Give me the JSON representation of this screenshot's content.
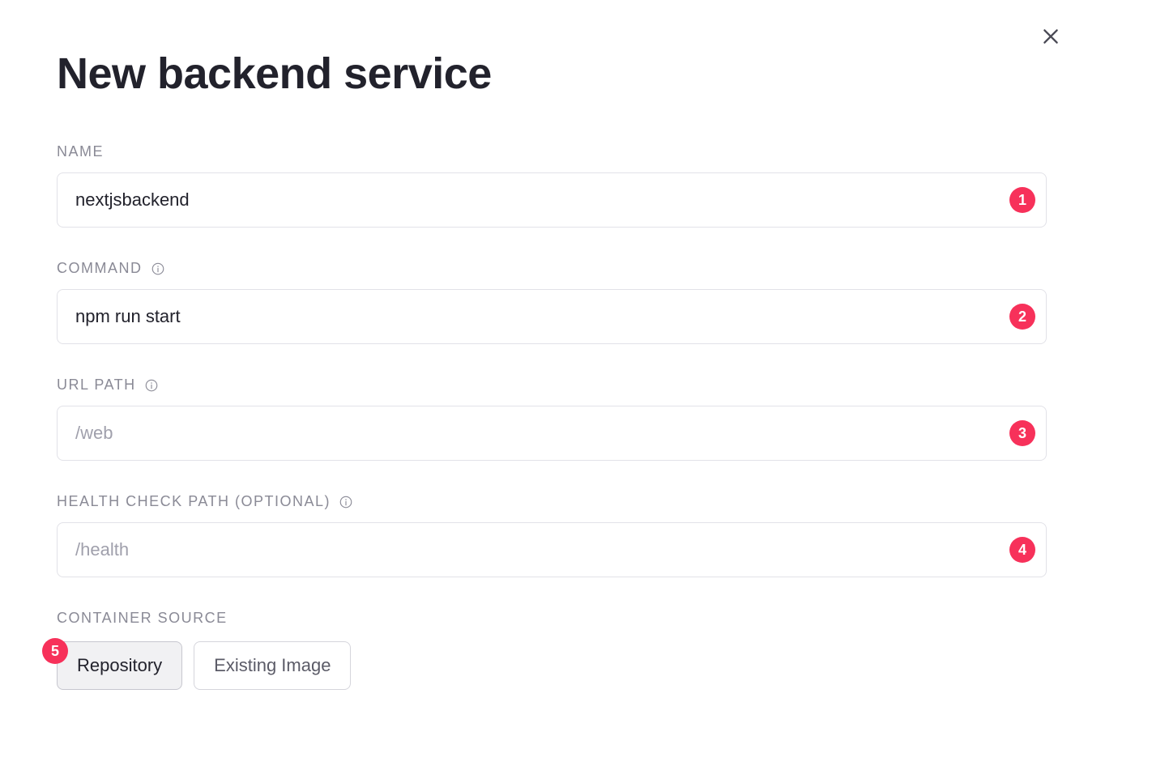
{
  "title": "New backend service",
  "close_icon": "close",
  "form": {
    "name": {
      "label": "NAME",
      "value": "nextjsbackend",
      "badge": "1"
    },
    "command": {
      "label": "COMMAND",
      "value": "npm run start",
      "has_info": true,
      "badge": "2"
    },
    "url_path": {
      "label": "URL PATH",
      "placeholder": "/web",
      "value": "",
      "has_info": true,
      "badge": "3"
    },
    "health_check": {
      "label": "HEALTH CHECK PATH (OPTIONAL)",
      "placeholder": "/health",
      "value": "",
      "has_info": true,
      "badge": "4"
    },
    "container_source": {
      "label": "CONTAINER SOURCE",
      "options": {
        "repository": "Repository",
        "existing_image": "Existing Image"
      },
      "selected": "repository",
      "badge": "5"
    }
  }
}
